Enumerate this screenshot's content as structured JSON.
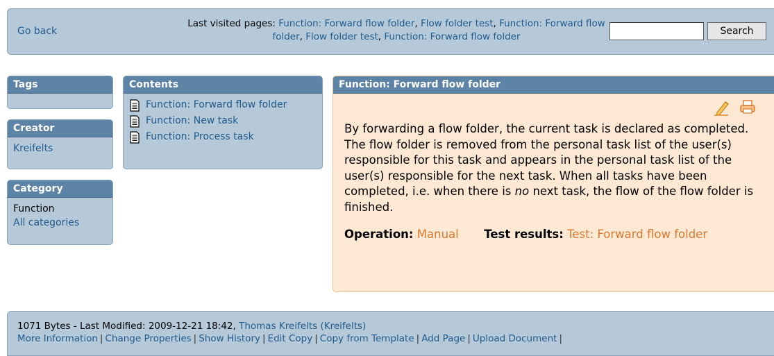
{
  "topbar": {
    "go_back": "Go back",
    "last_visited_prefix": "Last visited pages:",
    "last_visited": [
      "Function: Forward flow folder",
      "Flow folder test",
      "Function: Forward flow folder",
      "Flow folder test",
      "Function: Forward flow folder"
    ],
    "search_value": "",
    "search_button": "Search"
  },
  "tags": {
    "title": "Tags"
  },
  "creator": {
    "title": "Creator",
    "name": "Kreifelts"
  },
  "category": {
    "title": "Category",
    "value": "Function",
    "all_link": "All categories"
  },
  "contents": {
    "title": "Contents",
    "items": [
      "Function: Forward flow folder",
      "Function: New task",
      "Function: Process task"
    ]
  },
  "article": {
    "title": "Function: Forward flow folder",
    "text_1": "By forwarding a flow folder, the current task is declared as completed. The flow folder is removed from the personal task list of the user(s) responsible for this task and appears in the personal task list of the user(s) responsible for the next task. When all tasks have been completed, i.e. when there is ",
    "text_em": "no",
    "text_2": " next task, the flow of the flow folder is finished.",
    "operation_label": "Operation:",
    "operation_value": "Manual",
    "test_results_label": "Test results:",
    "test_results_value": "Test: Forward flow folder",
    "icons": [
      "edit-pencil-icon",
      "print-icon"
    ]
  },
  "footer": {
    "info_prefix": "1071 Bytes  -  Last Modified: 2009-12-21 18:42,",
    "author": "Thomas Kreifelts (Kreifelts)",
    "links": [
      "More Information",
      "Change Properties",
      "Show History",
      "Edit Copy",
      "Copy from Template",
      "Add Page",
      "Upload Document"
    ]
  },
  "colors": {
    "panel": "#b6c9d9",
    "header": "#5d83a7",
    "article_bg": "#fde9d3",
    "link": "#1f5a8c",
    "accent_link": "#d9782e"
  }
}
